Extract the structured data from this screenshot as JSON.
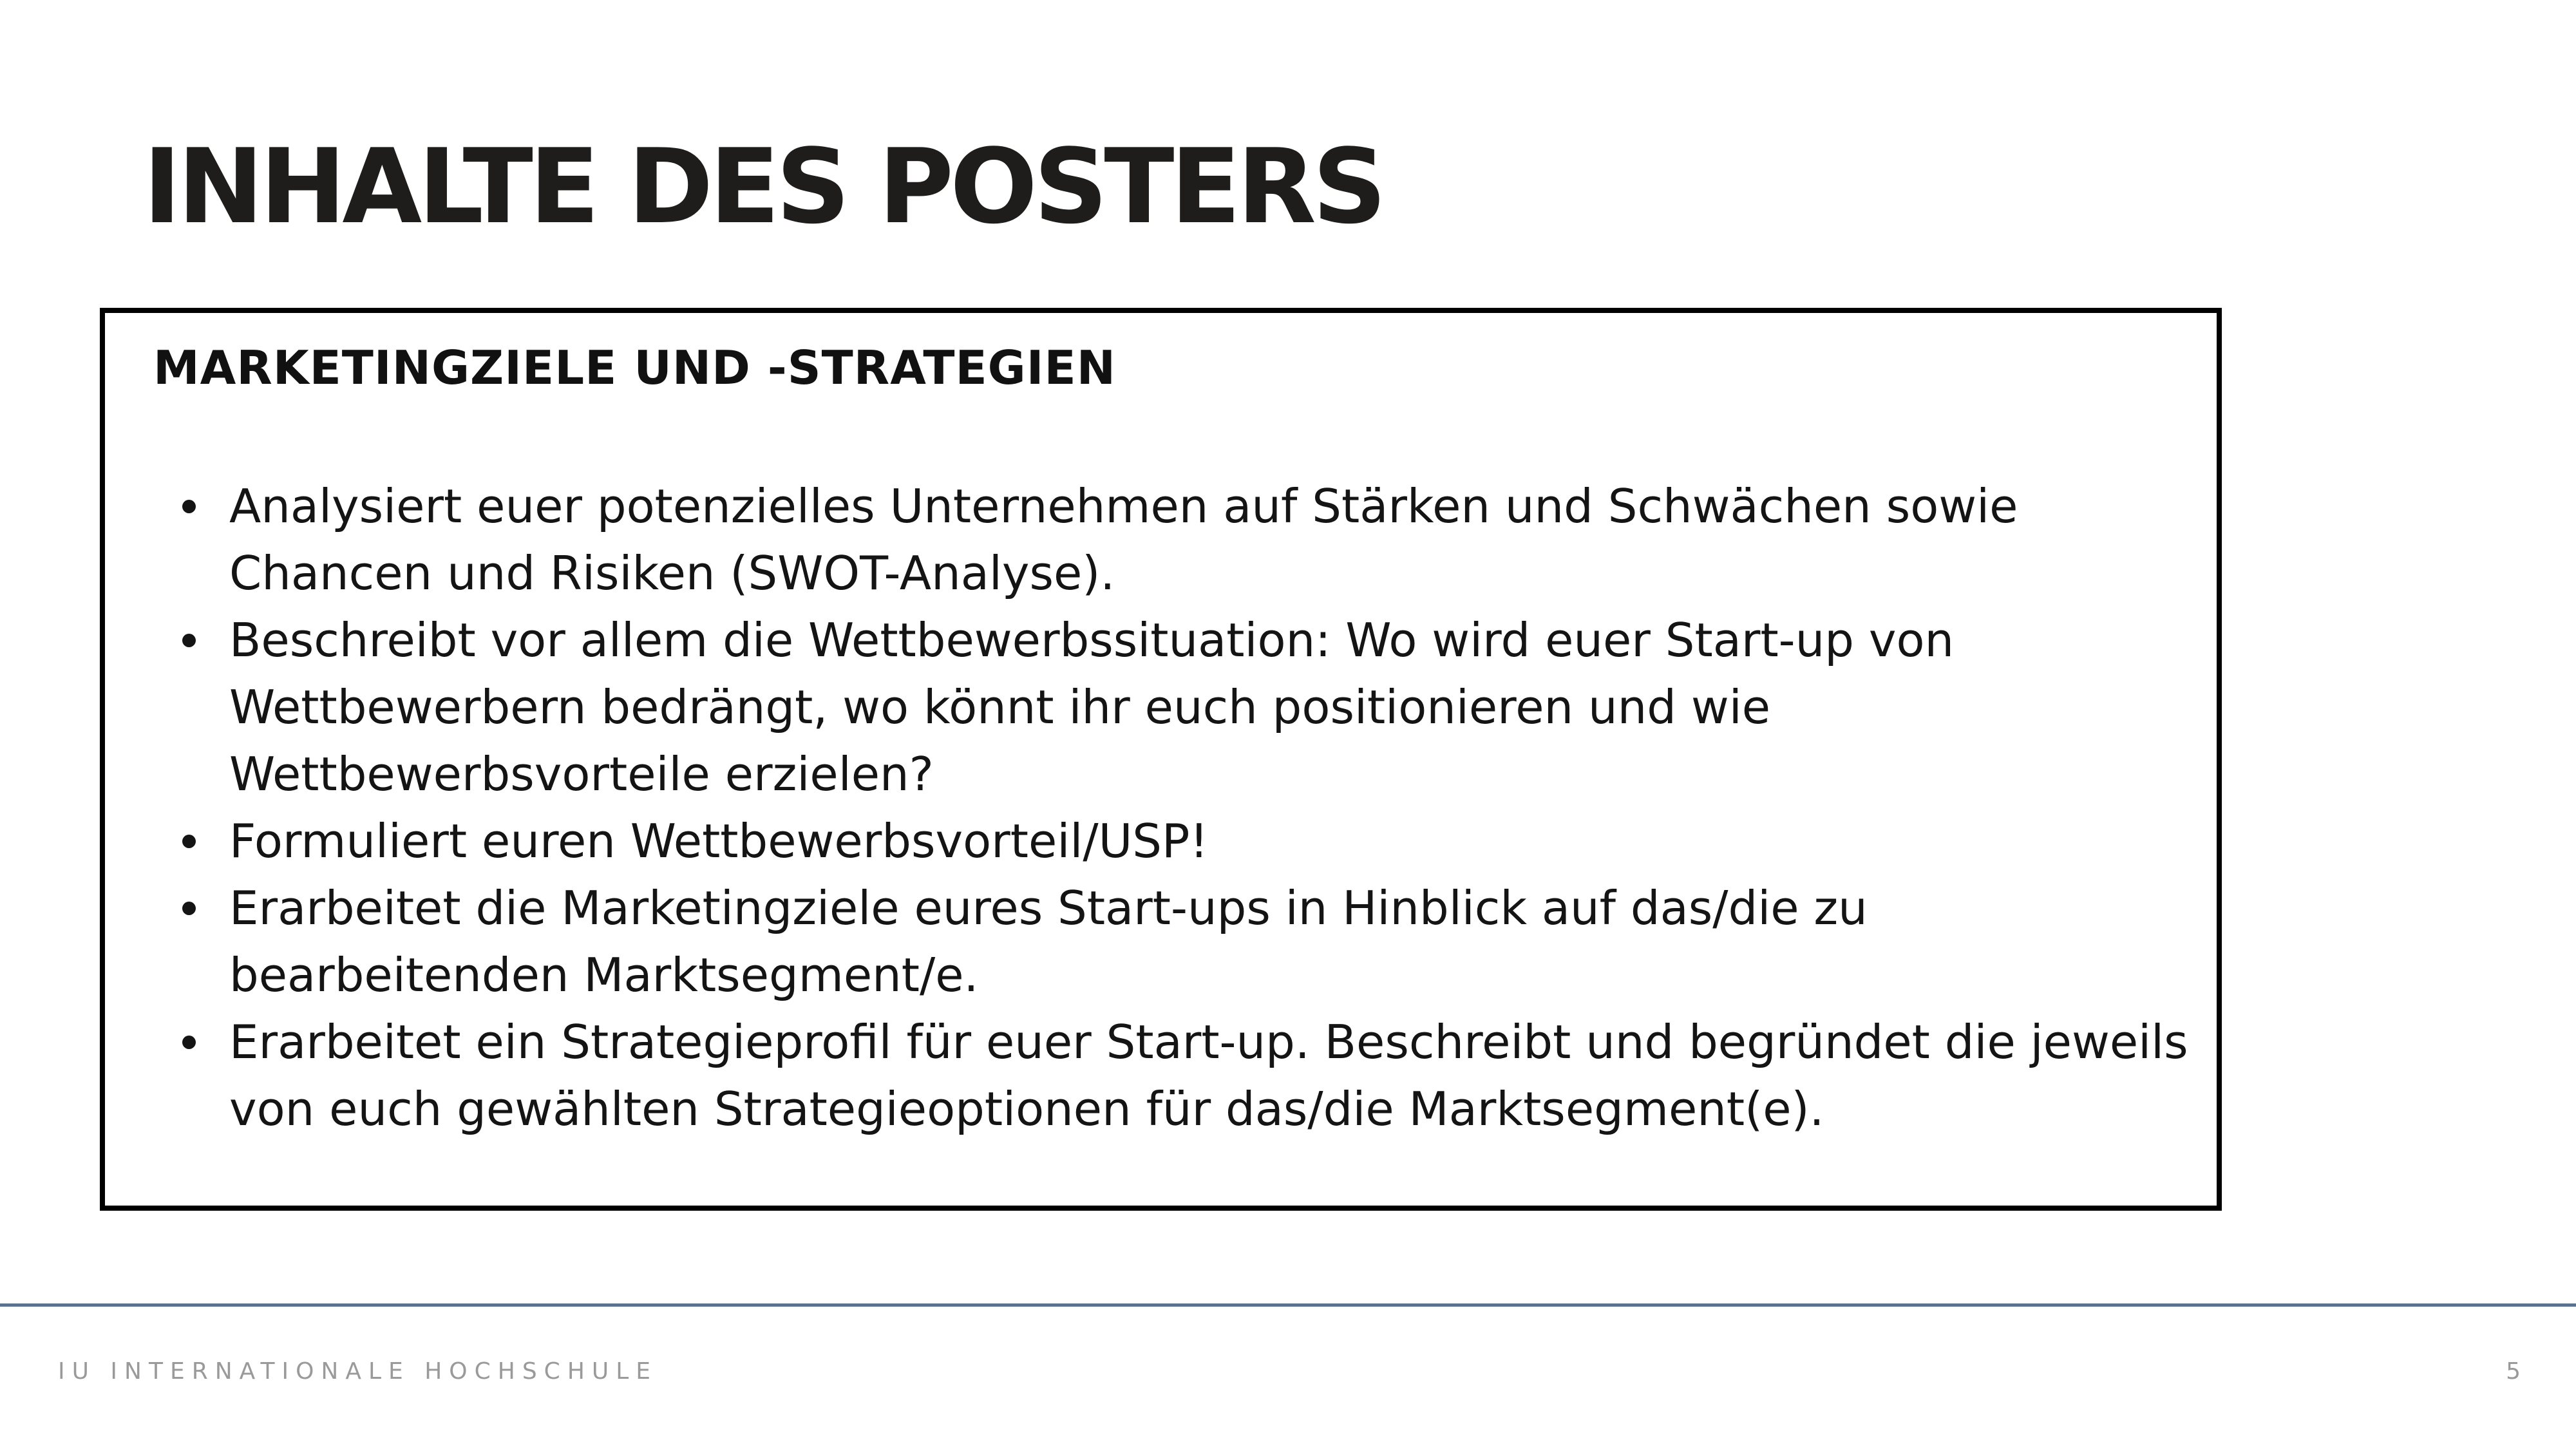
{
  "slide": {
    "title": "INHALTE DES POSTERS",
    "section_heading": "MARKETINGZIELE UND -STRATEGIEN",
    "bullets": [
      "Analysiert euer potenzielles Unternehmen auf Stärken und Schwächen sowie Chancen und Risiken (SWOT-Analyse).",
      "Beschreibt vor allem die Wettbewerbssituation: Wo wird euer Start-up von Wettbewerbern bedrängt, wo könnt ihr euch positionieren und wie Wettbewerbsvorteile erzielen?",
      "Formuliert euren Wettbewerbsvorteil/USP!",
      "Erarbeitet die Marketingziele eures Start-ups in Hinblick auf das/die zu bearbeitenden Marktsegment/e.",
      "Erarbeitet ein Strategieprofil für euer Start-up. Beschreibt und begründet die jeweils von euch gewählten Strategieoptionen für das/die Marktsegment(e)."
    ]
  },
  "footer": {
    "organization": "IU INTERNATIONALE HOCHSCHULE",
    "page_number": "5"
  },
  "colors": {
    "title": "#1f1d1c",
    "box_border": "#000000",
    "footer_line": "#5a7390",
    "footer_text": "#9a9a9a"
  }
}
